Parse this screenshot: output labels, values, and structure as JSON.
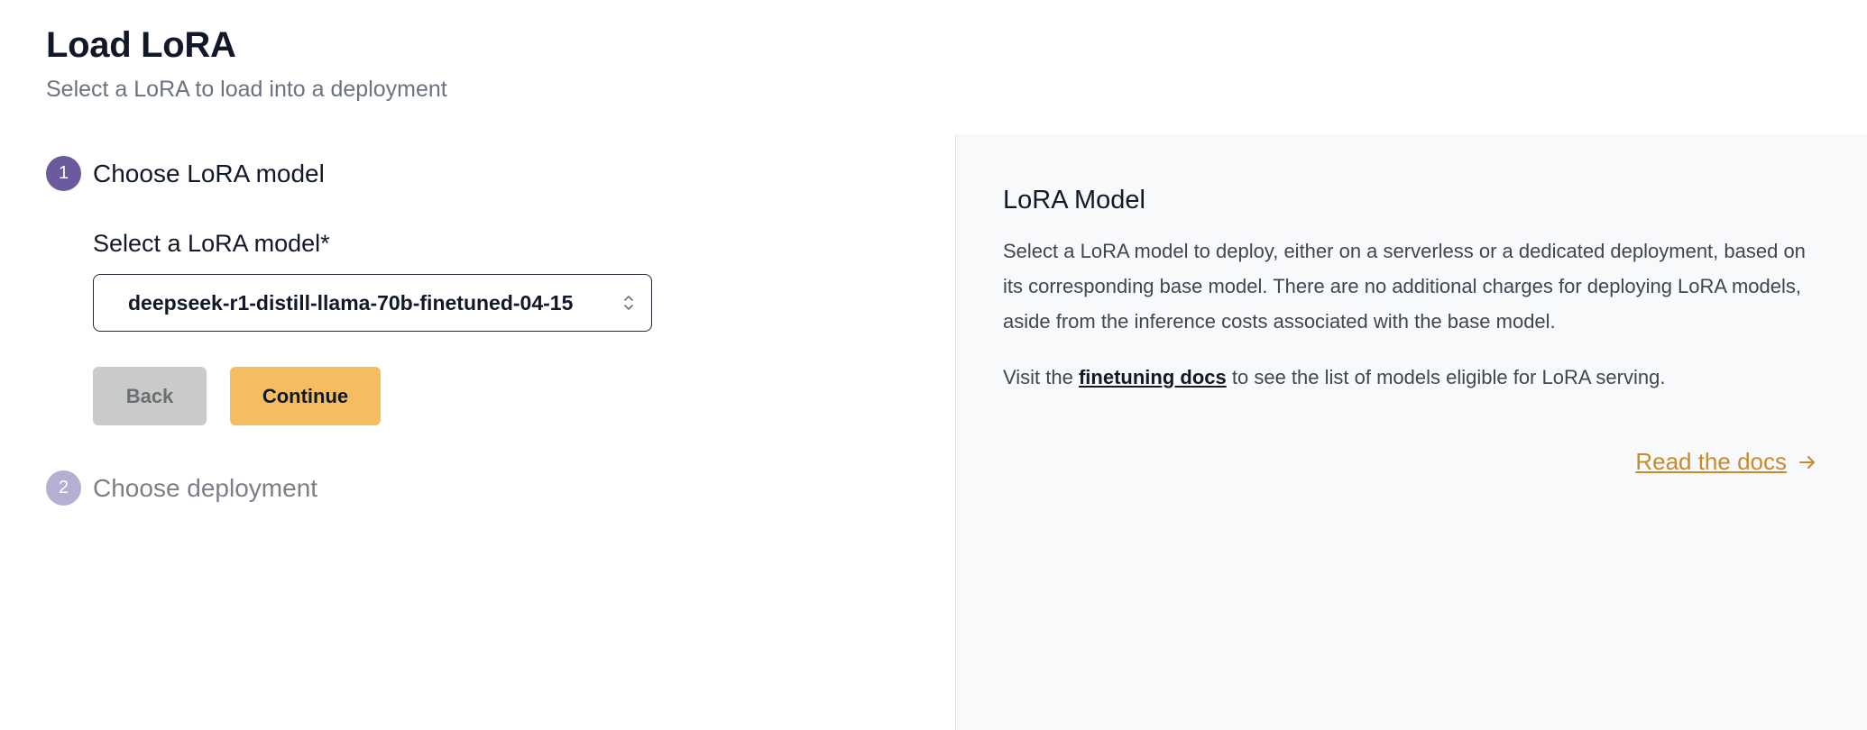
{
  "header": {
    "title": "Load LoRA",
    "subtitle": "Select a LoRA to load into a deployment"
  },
  "steps": [
    {
      "number": "1",
      "label": "Choose LoRA model",
      "state": "active"
    },
    {
      "number": "2",
      "label": "Choose deployment",
      "state": "inactive"
    }
  ],
  "form": {
    "field_label": "Select a LoRA model*",
    "selected_model": "deepseek-r1-distill-llama-70b-finetuned-04-15",
    "back_label": "Back",
    "continue_label": "Continue"
  },
  "panel": {
    "title": "LoRA Model",
    "description": "Select a LoRA model to deploy, either on a serverless or a dedicated deployment, based on its corresponding base model. There are no additional charges for deploying LoRA models, aside from the inference costs associated with the base model.",
    "visit_prefix": "Visit the",
    "visit_link": "finetuning docs",
    "visit_suffix": "to see the list of models eligible for LoRA serving.",
    "read_docs_label": "Read the docs"
  },
  "colors": {
    "step_active": "#6b5b9e",
    "step_inactive": "#b7aed4",
    "continue_button": "#f5bd60",
    "back_button": "#c9cbc9",
    "link_accent": "#c98a2e"
  },
  "icons": {
    "select": "chevron-up-down-icon",
    "read_docs": "arrow-right-icon"
  }
}
